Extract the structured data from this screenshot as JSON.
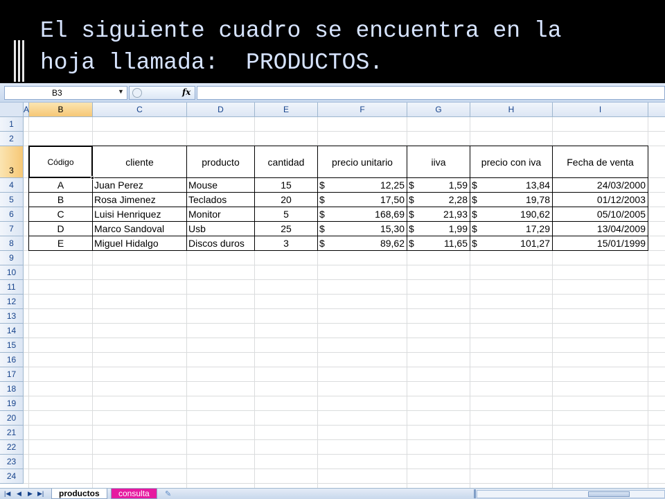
{
  "slide": {
    "title": "El siguiente cuadro se encuentra en la\nhoja llamada:  PRODUCTOS."
  },
  "excel": {
    "name_box": "B3",
    "fx_label": "fx",
    "columns": [
      "A",
      "B",
      "C",
      "D",
      "E",
      "F",
      "G",
      "H",
      "I"
    ],
    "rows": [
      "1",
      "2",
      "3",
      "4",
      "5",
      "6",
      "7",
      "8",
      "9",
      "10",
      "11",
      "12",
      "13",
      "14",
      "15",
      "16",
      "17",
      "18",
      "19",
      "20",
      "21",
      "22",
      "23",
      "24"
    ],
    "selected_cell": "B3",
    "table": {
      "headers": [
        "Código",
        "cliente",
        "producto",
        "cantidad",
        "precio unitario",
        "iiva",
        "precio con iva",
        "Fecha de venta"
      ],
      "currency_symbol": "$",
      "rows": [
        {
          "codigo": "A",
          "cliente": "Juan Perez",
          "producto": "Mouse",
          "cantidad": "15",
          "precio_unitario": "12,25",
          "iva": "1,59",
          "precio_con_iva": "13,84",
          "fecha": "24/03/2000"
        },
        {
          "codigo": "B",
          "cliente": "Rosa Jimenez",
          "producto": "Teclados",
          "cantidad": "20",
          "precio_unitario": "17,50",
          "iva": "2,28",
          "precio_con_iva": "19,78",
          "fecha": "01/12/2003"
        },
        {
          "codigo": "C",
          "cliente": "Luisi Henriquez",
          "producto": "Monitor",
          "cantidad": "5",
          "precio_unitario": "168,69",
          "iva": "21,93",
          "precio_con_iva": "190,62",
          "fecha": "05/10/2005"
        },
        {
          "codigo": "D",
          "cliente": "Marco Sandoval",
          "producto": "Usb",
          "cantidad": "25",
          "precio_unitario": "15,30",
          "iva": "1,99",
          "precio_con_iva": "17,29",
          "fecha": "13/04/2009"
        },
        {
          "codigo": "E",
          "cliente": "Miguel Hidalgo",
          "producto": "Discos duros",
          "cantidad": "3",
          "precio_unitario": "89,62",
          "iva": "11,65",
          "precio_con_iva": "101,27",
          "fecha": "15/01/1999"
        }
      ]
    },
    "sheet_tabs": [
      {
        "label": "productos",
        "active": true
      },
      {
        "label": "consulta",
        "active": false,
        "color": "#e61aa0"
      }
    ]
  }
}
